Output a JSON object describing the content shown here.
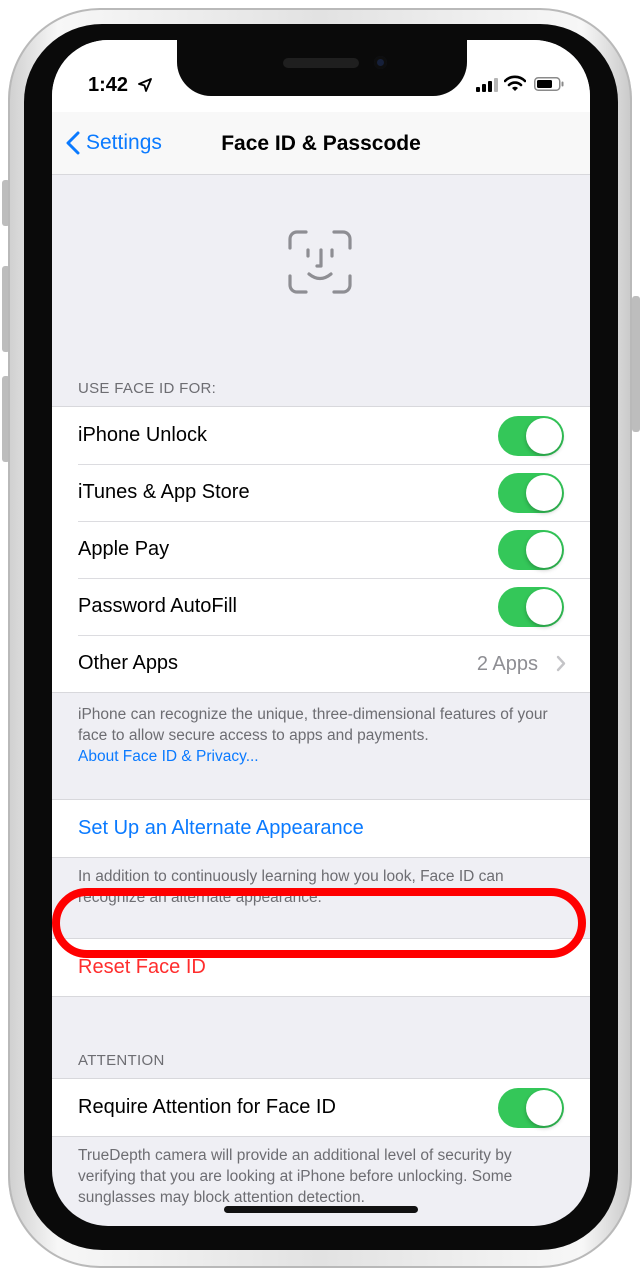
{
  "status_bar": {
    "time": "1:42"
  },
  "nav": {
    "back_label": "Settings",
    "title": "Face ID & Passcode"
  },
  "use_face_id_section": {
    "header": "USE FACE ID FOR:",
    "rows": [
      {
        "label": "iPhone Unlock",
        "toggle": "on"
      },
      {
        "label": "iTunes & App Store",
        "toggle": "on"
      },
      {
        "label": "Apple Pay",
        "toggle": "on"
      },
      {
        "label": "Password AutoFill",
        "toggle": "on"
      },
      {
        "label": "Other Apps",
        "value": "2 Apps"
      }
    ],
    "footer_text": "iPhone can recognize the unique, three-dimensional features of your face to allow secure access to apps and payments.",
    "footer_link": "About Face ID & Privacy..."
  },
  "alternate_section": {
    "label": "Set Up an Alternate Appearance",
    "footer_text": "In addition to continuously learning how you look, Face ID can recognize an alternate appearance."
  },
  "reset_section": {
    "label": "Reset Face ID"
  },
  "attention_section": {
    "header": "ATTENTION",
    "rows": [
      {
        "label": "Require Attention for Face ID",
        "toggle": "on"
      }
    ],
    "footer_text": "TrueDepth camera will provide an additional level of security by verifying that you are looking at iPhone before unlocking. Some sunglasses may block attention detection."
  },
  "colors": {
    "accent": "#0a7aff",
    "toggle_on": "#34c759",
    "destructive": "#ff2d2d",
    "highlight": "#ff0000",
    "background": "#efeff4"
  },
  "icons": {
    "hero": "face-id-icon",
    "back": "chevron-left-icon",
    "disclosure": "chevron-right-icon"
  }
}
